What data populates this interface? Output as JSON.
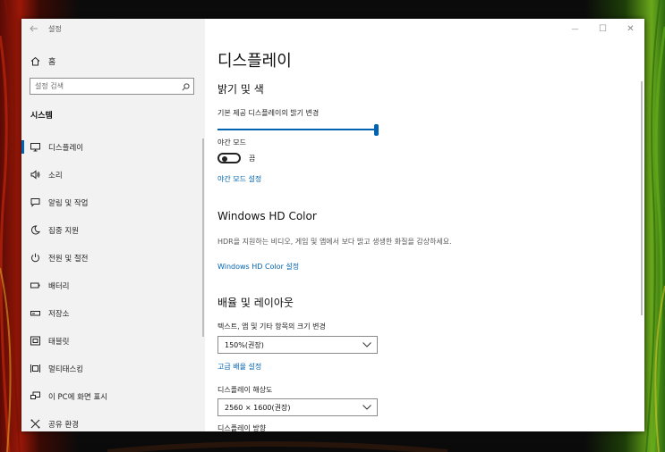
{
  "window": {
    "title": "설정",
    "controls": {
      "minimize": "—",
      "maximize": "☐",
      "close": "✕"
    }
  },
  "sidebar": {
    "home_label": "홈",
    "search_placeholder": "설정 검색",
    "section_label": "시스템",
    "items": [
      {
        "label": "디스플레이",
        "icon": "monitor-icon",
        "active": true
      },
      {
        "label": "소리",
        "icon": "speaker-icon",
        "active": false
      },
      {
        "label": "알림 및 작업",
        "icon": "notification-icon",
        "active": false
      },
      {
        "label": "집중 지원",
        "icon": "moon-icon",
        "active": false
      },
      {
        "label": "전원 및 절전",
        "icon": "power-icon",
        "active": false
      },
      {
        "label": "배터리",
        "icon": "battery-icon",
        "active": false
      },
      {
        "label": "저장소",
        "icon": "storage-icon",
        "active": false
      },
      {
        "label": "태블릿",
        "icon": "tablet-icon",
        "active": false
      },
      {
        "label": "멀티태스킹",
        "icon": "multitasking-icon",
        "active": false
      },
      {
        "label": "이 PC에 화면 표시",
        "icon": "project-icon",
        "active": false
      },
      {
        "label": "공유 환경",
        "icon": "shared-icon",
        "active": false
      }
    ]
  },
  "content": {
    "page_title": "디스플레이",
    "brightness": {
      "heading": "밝기 및 색",
      "slider_label": "기본 제공 디스플레이의 밝기 변경",
      "slider_value": 100,
      "night_light_label": "야간 모드",
      "night_light_state": "끔",
      "night_light_settings_link": "야간 모드 설정"
    },
    "hdr": {
      "heading": "Windows HD Color",
      "description": "HDR을 지원하는 비디오, 게임 및 앱에서 보다 밝고 생생한 화질을 감상하세요.",
      "link": "Windows HD Color 설정"
    },
    "scale": {
      "heading": "배율 및 레이아웃",
      "scale_label": "텍스트, 앱 및 기타 항목의 크기 변경",
      "scale_value": "150%(권장)",
      "advanced_link": "고급 배율 설정",
      "resolution_label": "디스플레이 해상도",
      "resolution_value": "2560 × 1600(권장)",
      "orientation_label": "디스플레이 방향"
    }
  },
  "colors": {
    "accent": "#0063b1",
    "sidebar_bg": "#f2f2f2"
  }
}
